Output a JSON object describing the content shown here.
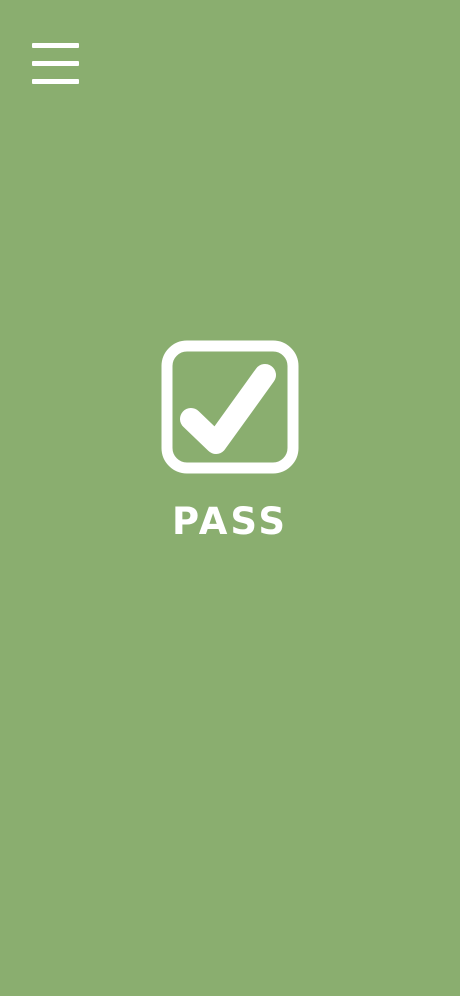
{
  "menu": {
    "icon": "hamburger-menu-icon"
  },
  "status": {
    "icon": "checkbox-checked-icon",
    "label": "PASS",
    "background_color": "#8aae6f",
    "foreground_color": "#ffffff"
  }
}
